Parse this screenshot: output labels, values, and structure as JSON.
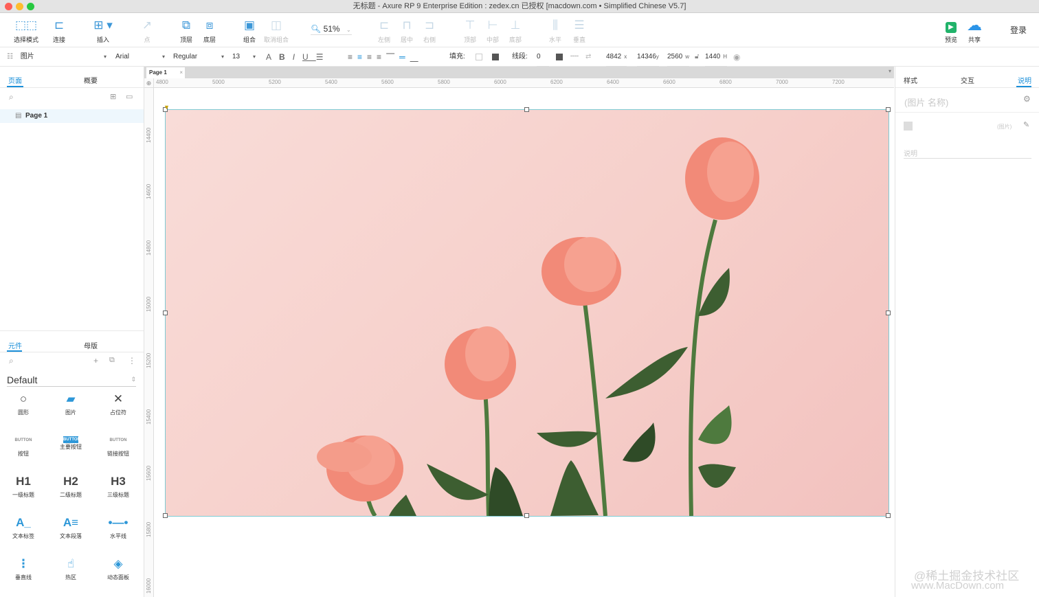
{
  "window": {
    "title": "无标题 - Axure RP 9 Enterprise Edition : zedex.cn 已授权     [macdown.com • Simplified Chinese V5.7]"
  },
  "toolbar": {
    "select_mode": "选择模式",
    "connect": "连接",
    "insert": "插入",
    "point": "点",
    "top": "顶层",
    "bottom": "底层",
    "group": "组合",
    "ungroup": "取消组合",
    "zoom": "51%",
    "left": "左侧",
    "center": "居中",
    "right": "右侧",
    "top_align": "顶部",
    "middle": "中部",
    "bottom_align": "底部",
    "horizontal": "水平",
    "vertical": "垂直",
    "preview": "预览",
    "share": "共享",
    "login": "登录"
  },
  "format": {
    "widget_type": "图片",
    "font": "Arial",
    "weight": "Regular",
    "size": "13",
    "fill_label": "填充:",
    "stroke_label": "线段:",
    "stroke_value": "0",
    "x": "4842",
    "x_unit": "x",
    "y": "14346",
    "y_unit": "y",
    "w": "2560",
    "w_unit": "w",
    "h": "1440",
    "h_unit": "H"
  },
  "left_panel": {
    "tabs": [
      "页面",
      "概要"
    ],
    "pages": [
      {
        "label": "Page 1"
      }
    ],
    "widget_tabs": [
      "元件",
      "母版"
    ],
    "library": "Default",
    "widgets": [
      {
        "label": "圆形",
        "icon": "○"
      },
      {
        "label": "图片",
        "icon": "▰"
      },
      {
        "label": "占位符",
        "icon": "✕"
      },
      {
        "label": "按钮",
        "icon": "BUTTON"
      },
      {
        "label": "主要按钮",
        "icon": "BUTTON"
      },
      {
        "label": "链接按钮",
        "icon": "BUTTON"
      },
      {
        "label": "一级标题",
        "icon": "H1"
      },
      {
        "label": "二级标题",
        "icon": "H2"
      },
      {
        "label": "三级标题",
        "icon": "H3"
      },
      {
        "label": "文本标签",
        "icon": "A_"
      },
      {
        "label": "文本段落",
        "icon": "A≡"
      },
      {
        "label": "水平线",
        "icon": "•—•"
      },
      {
        "label": "垂直线",
        "icon": "⋮"
      },
      {
        "label": "热区",
        "icon": "☝"
      },
      {
        "label": "动态面板",
        "icon": "◈"
      }
    ]
  },
  "canvas": {
    "tab": "Page 1",
    "ruler_h": [
      "4800",
      "5000",
      "5200",
      "5400",
      "5600",
      "5800",
      "6000",
      "6200",
      "6400",
      "6600",
      "6800",
      "7000",
      "7200"
    ],
    "ruler_v": [
      "14400",
      "14600",
      "14800",
      "15000",
      "15200",
      "15400",
      "15600",
      "15800",
      "16000"
    ]
  },
  "right_panel": {
    "tabs": [
      "样式",
      "交互",
      "说明"
    ],
    "name_placeholder": "(图片 名称)",
    "type_label": "(图片)",
    "notes_placeholder": "说明"
  },
  "watermark": {
    "line1": "@稀土掘金技术社区",
    "line2": "www.MacDown.com"
  },
  "colors": {
    "accent": "#1a8fd9",
    "selection": "#7ecbd4",
    "rose": "#f28a78",
    "leaf": "#4e7a3e"
  }
}
